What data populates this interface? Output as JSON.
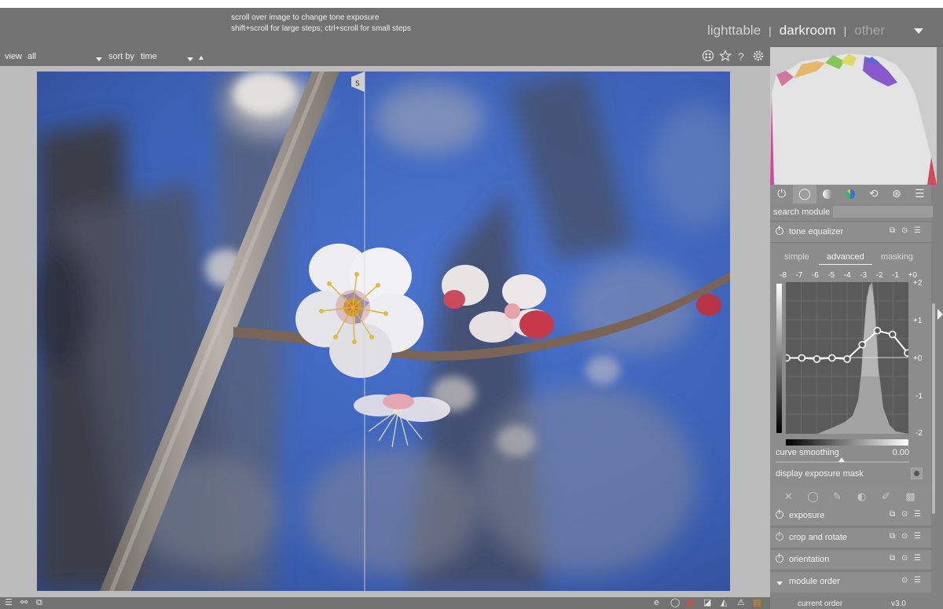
{
  "header": {
    "hint_line1": "scroll over image to change tone exposure",
    "hint_line2": "shift+scroll for large steps; ctrl+scroll for small steps",
    "views": [
      {
        "label": "lighttable",
        "active": false
      },
      {
        "label": "darkroom",
        "active": true
      },
      {
        "label": "other",
        "active": false
      }
    ],
    "separator": "|"
  },
  "filterbar": {
    "view_label": "view",
    "view_value": "all",
    "sort_label": "sort by",
    "sort_value": "time"
  },
  "right_panel": {
    "tabs": [
      "power-icon",
      "circle-icon",
      "gradient-circle-icon",
      "color-circle-icon",
      "correction-icon",
      "effects-icon",
      "menu-icon"
    ],
    "search_label": "search module",
    "search_value": "",
    "tone_equalizer": {
      "title": "tone equalizer",
      "subtabs": [
        "simple",
        "advanced",
        "masking"
      ],
      "active_subtab": "advanced",
      "ev_labels": [
        "-8",
        "-7",
        "-6",
        "-5",
        "-4",
        "-3",
        "-2",
        "-1",
        "+0"
      ],
      "y_labels": [
        "+2",
        "+1",
        "+0",
        "-1",
        "-2"
      ],
      "curve_values": [
        0,
        0,
        -0.03,
        0,
        -0.03,
        0.35,
        0.72,
        0.62,
        0.13
      ],
      "curve_smoothing_label": "curve smoothing",
      "curve_smoothing_value": "0.00",
      "mask_label": "display exposure mask"
    },
    "modules": [
      {
        "name": "exposure"
      },
      {
        "name": "crop and rotate"
      },
      {
        "name": "orientation"
      }
    ],
    "module_order": {
      "title": "module order",
      "current_label": "current order",
      "current_value": "v3.0"
    }
  },
  "colors": {
    "panel": "#828282",
    "header": "#727272",
    "sky": "#3e63b6"
  }
}
